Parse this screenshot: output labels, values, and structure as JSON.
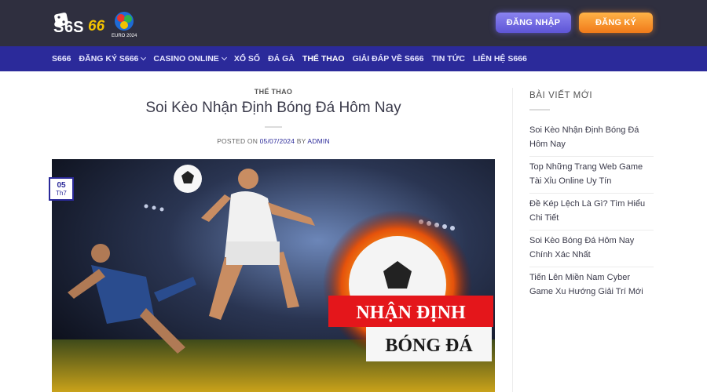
{
  "header": {
    "logo_text": "S6S66",
    "logo_sub": "EURO 2024",
    "login_label": "ĐĂNG NHẬP",
    "register_label": "ĐĂNG KÝ",
    "bg_color": "#2f2f3f"
  },
  "nav": {
    "bg_color": "#2b2a9a",
    "items": [
      {
        "label": "S666",
        "has_dropdown": false
      },
      {
        "label": "ĐĂNG KÝ S666",
        "has_dropdown": true
      },
      {
        "label": "CASINO ONLINE",
        "has_dropdown": true
      },
      {
        "label": "XỔ SỐ",
        "has_dropdown": false
      },
      {
        "label": "ĐÁ GÀ",
        "has_dropdown": false
      },
      {
        "label": "THỂ THAO",
        "has_dropdown": false,
        "active": true
      },
      {
        "label": "GIẢI ĐÁP VỀ S666",
        "has_dropdown": false
      },
      {
        "label": "TIN TỨC",
        "has_dropdown": false
      },
      {
        "label": "LIÊN HỆ S666",
        "has_dropdown": false
      }
    ]
  },
  "article": {
    "category": "THỂ THAO",
    "title": "Soi Kèo Nhận Định Bóng Đá Hôm Nay",
    "meta_prefix": "POSTED ON",
    "date": "05/07/2024",
    "meta_by": "BY",
    "author": "ADMIN",
    "badge_day": "05",
    "badge_month": "Th7",
    "hero_text_line1": "NHẬN ĐỊNH",
    "hero_text_line2": "BÓNG ĐÁ"
  },
  "sidebar": {
    "title": "BÀI VIẾT MỚI",
    "posts": [
      "Soi Kèo Nhận Định Bóng Đá Hôm Nay",
      "Top Những Trang Web Game Tài Xỉu Online Uy Tín",
      "Đề Kép Lệch Là Gì? Tìm Hiểu Chi Tiết",
      "Soi Kèo Bóng Đá Hôm Nay Chính Xác Nhất",
      "Tiến Lên Miền Nam Cyber Game Xu Hướng Giải Trí Mới"
    ]
  }
}
